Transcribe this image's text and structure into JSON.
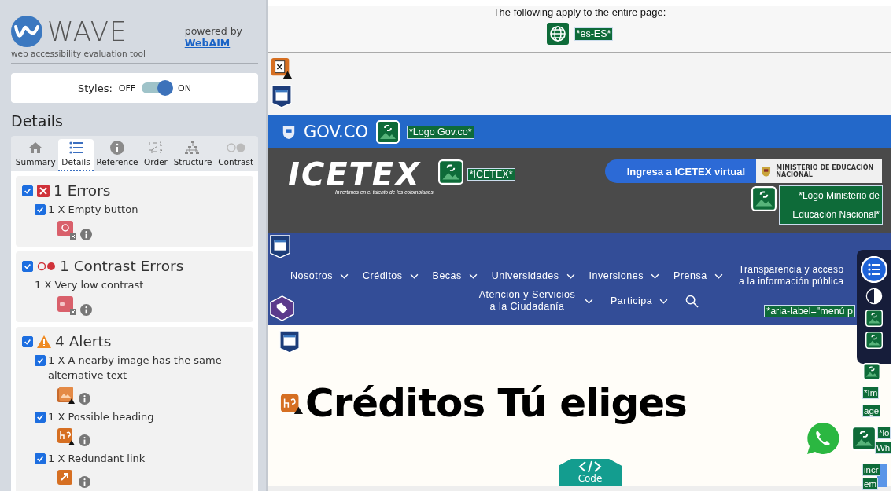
{
  "sidebar": {
    "logo": {
      "title": "WAVE",
      "subtitle": "web accessibility evaluation tool"
    },
    "powered_by": {
      "text": "powered by",
      "link": "WebAIM"
    },
    "styles_toggle": {
      "label": "Styles:",
      "off_label": "OFF",
      "on_label": "ON",
      "on": true
    },
    "heading": "Details",
    "tabs": [
      {
        "kind": "summary",
        "label": "Summary",
        "selected": false
      },
      {
        "kind": "details",
        "label": "Details",
        "selected": true
      },
      {
        "kind": "reference",
        "label": "Reference",
        "selected": false
      },
      {
        "kind": "order",
        "label": "Order",
        "selected": false
      },
      {
        "kind": "structure",
        "label": "Structure",
        "selected": false
      },
      {
        "kind": "contrast",
        "label": "Contrast",
        "selected": false
      }
    ],
    "groups": [
      {
        "kind": "errors",
        "title": "1 Errors",
        "checked": true,
        "items": [
          {
            "kind": "empty-button",
            "text": "1 X Empty button",
            "checked": true
          }
        ]
      },
      {
        "kind": "contrast",
        "title": "1 Contrast Errors",
        "checked": true,
        "items": [
          {
            "kind": "low-contrast",
            "text": "1 X Very low contrast"
          }
        ]
      },
      {
        "kind": "alerts",
        "title": "4 Alerts",
        "checked": true,
        "items": [
          {
            "kind": "same-alt",
            "text": "1 X A nearby image has the same alternative text",
            "checked": true
          },
          {
            "kind": "possible-heading",
            "text": "1 X Possible heading",
            "checked": true
          },
          {
            "kind": "redundant-link",
            "text": "1 X Redundant link",
            "checked": true
          }
        ]
      }
    ]
  },
  "page": {
    "notice": "The following apply to the entire page:",
    "language_label": "*es-ES*",
    "gov_bar": {
      "brand": "GOV.CO",
      "alt_label": "*Logo Gov.co*"
    },
    "header": {
      "logo_text": "ICETEX",
      "tagline": "Invertimos en el talento de los colombianos",
      "alt_label": "*ICETEX*",
      "button": "Ingresa a ICETEX virtual",
      "ministry": "MINISTERIO DE EDUCACIÓN NACIONAL",
      "ministry_alt_label": "*Logo Ministerio de Educación Nacional*"
    },
    "nav": {
      "items": [
        {
          "label": "Nosotros",
          "dropdown": true
        },
        {
          "label": "Créditos",
          "dropdown": true
        },
        {
          "label": "Becas",
          "dropdown": true
        },
        {
          "label": "Universidades",
          "dropdown": true
        },
        {
          "label": "Inversiones",
          "dropdown": true
        },
        {
          "label": "Prensa",
          "dropdown": true
        },
        {
          "label": "Transparencia y acceso a la información pública",
          "dropdown": false
        }
      ],
      "row2": [
        {
          "label": "Atención y Servicios a la Ciudadanía",
          "dropdown": true
        },
        {
          "label": "Participa",
          "dropdown": true
        }
      ],
      "aria_label": "*aria-label=\"menú p"
    },
    "heading": "Créditos Tú eliges",
    "code_tab": "Code",
    "fragments": [
      "*Im",
      "age",
      "*lo",
      "Wh",
      "incr",
      "em"
    ]
  }
}
